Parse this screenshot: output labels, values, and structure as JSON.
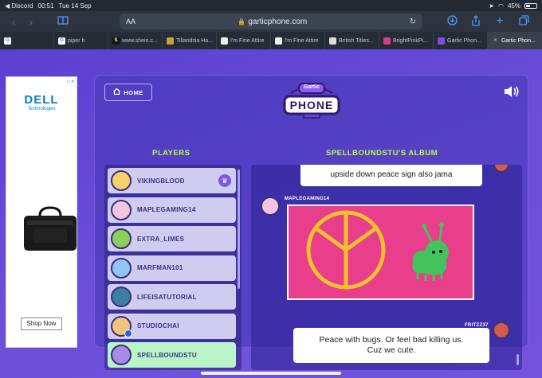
{
  "status_bar": {
    "back_app": "◀ Discord",
    "time": "00:51",
    "date": "Tue 14 Sep",
    "battery": "45%",
    "battery_level": 0.45
  },
  "browser": {
    "text_size_label": "AA",
    "url": "garticphone.com"
  },
  "tabs": [
    {
      "label": "",
      "icon": "google-icon",
      "color": "#ffffff"
    },
    {
      "label": "piper h",
      "icon": "google-icon",
      "color": "#ffffff"
    },
    {
      "label": "www.shein.c...",
      "icon": "shein-icon",
      "color": "#111111"
    },
    {
      "label": "Tillandsia Ha...",
      "icon": "tillandsia-icon",
      "color": "#c9a23a"
    },
    {
      "label": "I'm Fine Attire",
      "icon": "page-icon",
      "color": "#eeeeee"
    },
    {
      "label": "I'm Fine Attire",
      "icon": "page-icon",
      "color": "#eeeeee"
    },
    {
      "label": "British Titles...",
      "icon": "doc-icon",
      "color": "#dddddd"
    },
    {
      "label": "BrightPinkPi...",
      "icon": "bright-icon",
      "color": "#d23f8c"
    },
    {
      "label": "Gartic Phon...",
      "icon": "gartic-icon",
      "color": "#7b4de0"
    },
    {
      "label": "Gartic Phon...",
      "icon": "close-icon",
      "color": "#3a414d"
    }
  ],
  "ad": {
    "brand": "DELL",
    "brand_sub": "Technologies",
    "cta": "Shop Now"
  },
  "game": {
    "home_label": "HOME",
    "logo_top": "Gartic",
    "logo_main": "PHONE",
    "players_title": "PLAYERS",
    "album_title": "SPELLBOUNDSTU'S ALBUM",
    "players": [
      {
        "name": "VIKINGBLOOD",
        "host": true,
        "active": false,
        "avatar_color": "#f5d36a"
      },
      {
        "name": "MAPLEGAMING14",
        "host": false,
        "active": false,
        "avatar_color": "#f2c6e0"
      },
      {
        "name": "EXTRA_LIMES",
        "host": false,
        "active": false,
        "avatar_color": "#8ccf5a"
      },
      {
        "name": "MARFMAN101",
        "host": false,
        "active": false,
        "avatar_color": "#8ec6f5"
      },
      {
        "name": "LIFEISATUTORIAL",
        "host": false,
        "active": false,
        "avatar_color": "#3d7ea6"
      },
      {
        "name": "STUDIOCHAI",
        "host": false,
        "active": false,
        "avatar_color": "#f0c27a"
      },
      {
        "name": "SPELLBOUNDSTU",
        "host": false,
        "active": true,
        "avatar_color": "#a88ae8"
      }
    ],
    "album": {
      "top_caption": "upside down peace sign also jama",
      "drawer_name": "MAPLEGAMING14",
      "bottom_user": "FRITZZ37",
      "bottom_caption_line1": "Peace with bugs. Or feel bad killing us.",
      "bottom_caption_line2": "Cuz we cute."
    }
  }
}
